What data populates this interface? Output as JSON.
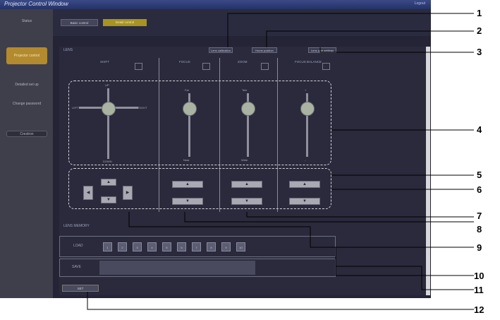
{
  "window": {
    "title": "Projector Control Window",
    "top_right": "Logout"
  },
  "sidebar": {
    "items": [
      {
        "label": "Status",
        "active": false
      },
      {
        "label": "Projector control",
        "active": true
      },
      {
        "label": "Detailed set up",
        "active": false
      },
      {
        "label": "Change password",
        "active": false
      },
      {
        "label": "Crestron",
        "active": false
      }
    ]
  },
  "tabs": [
    {
      "label": "Basic control"
    },
    {
      "label": "Detail control"
    }
  ],
  "lens": {
    "title": "LENS",
    "buttons": [
      "Lens calibration",
      "Home position",
      "Lens type settings"
    ],
    "columns": [
      {
        "label": "SHIFT",
        "top": "UP",
        "bottom": "DOWN",
        "left": "LEFT",
        "right": "RIGHT"
      },
      {
        "label": "FOCUS",
        "top": "Far",
        "bottom": "Near"
      },
      {
        "label": "ZOOM",
        "top": "Tele",
        "bottom": "Wide"
      },
      {
        "label": "FOCUS BALANCE",
        "top": "+",
        "bottom": "-"
      }
    ]
  },
  "lens_memory": {
    "title": "LENS MEMORY",
    "row1_label": "LOAD",
    "row2_label": "SAVE",
    "slots": [
      "1",
      "2",
      "3",
      "4",
      "5",
      "6",
      "7",
      "8",
      "9",
      "10"
    ],
    "set_button": "SET"
  },
  "callouts": [
    "1",
    "2",
    "3",
    "4",
    "5",
    "6",
    "7",
    "8",
    "9",
    "10",
    "11",
    "12"
  ]
}
